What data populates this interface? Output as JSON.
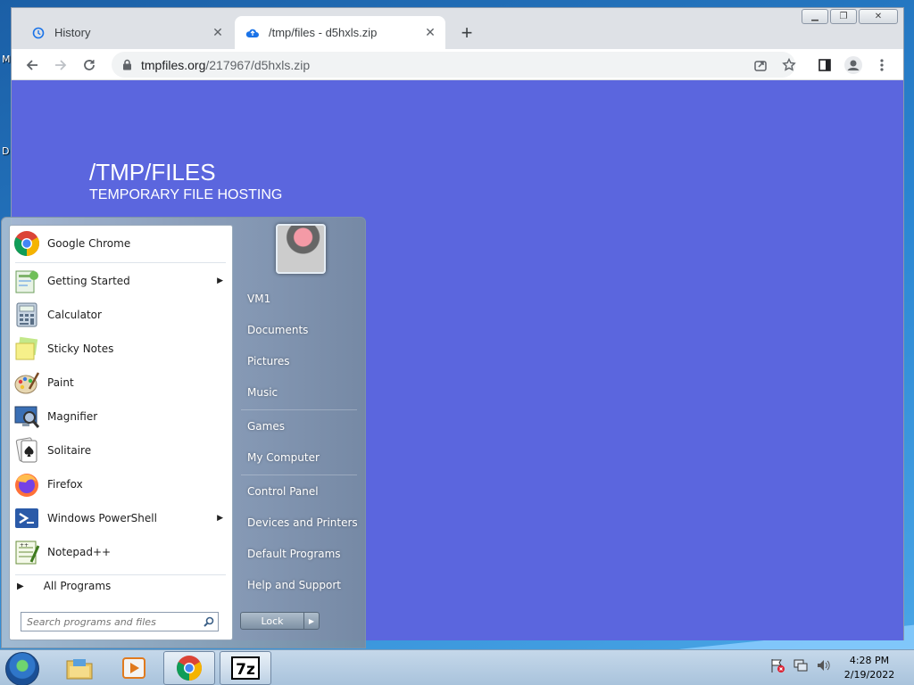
{
  "desktop": {
    "partial_labels": [
      "M",
      "D"
    ]
  },
  "browser": {
    "tabs": [
      {
        "title": "History",
        "icon": "history-icon"
      },
      {
        "title": "/tmp/files - d5hxls.zip",
        "icon": "upload-cloud-icon"
      }
    ],
    "url": {
      "host": "tmpfiles.org",
      "path": "/217967/d5hxls.zip"
    }
  },
  "page": {
    "title": "/TMP/FILES",
    "subtitle": "TEMPORARY FILE HOSTING",
    "background": "#5b66de"
  },
  "start_menu": {
    "pinned": [
      {
        "label": "Google Chrome",
        "icon": "chrome-icon"
      }
    ],
    "programs": [
      {
        "label": "Getting Started",
        "icon": "getting-started-icon",
        "submenu": true
      },
      {
        "label": "Calculator",
        "icon": "calculator-icon",
        "submenu": false
      },
      {
        "label": "Sticky Notes",
        "icon": "sticky-notes-icon",
        "submenu": false
      },
      {
        "label": "Paint",
        "icon": "paint-icon",
        "submenu": false
      },
      {
        "label": "Magnifier",
        "icon": "magnifier-icon",
        "submenu": false
      },
      {
        "label": "Solitaire",
        "icon": "solitaire-icon",
        "submenu": false
      },
      {
        "label": "Firefox",
        "icon": "firefox-icon",
        "submenu": false
      },
      {
        "label": "Windows PowerShell",
        "icon": "powershell-icon",
        "submenu": true
      },
      {
        "label": "Notepad++",
        "icon": "notepad-plus-plus-icon",
        "submenu": false
      }
    ],
    "all_programs": "All Programs",
    "search_placeholder": "Search programs and files",
    "right_items": [
      "VM1",
      "Documents",
      "Pictures",
      "Music",
      "Games",
      "My Computer",
      "Control Panel",
      "Devices and Printers",
      "Default Programs",
      "Help and Support"
    ],
    "lock_label": "Lock"
  },
  "taskbar": {
    "apps": [
      "explorer-icon",
      "media-player-icon",
      "chrome-icon",
      "7zip-icon"
    ],
    "sevenzip_label": "7z",
    "clock": {
      "time": "4:28 PM",
      "date": "2/19/2022"
    }
  }
}
